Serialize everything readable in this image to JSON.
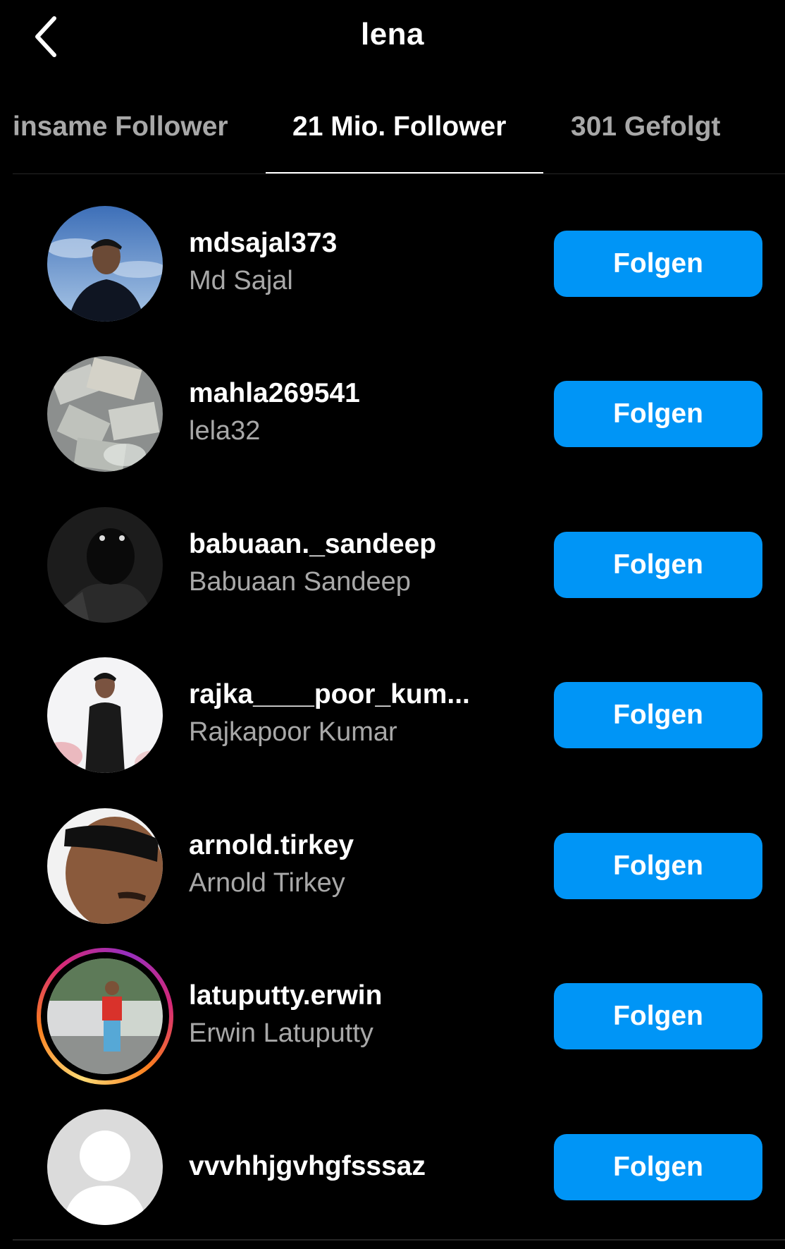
{
  "header": {
    "title": "lena",
    "back_icon": "chevron-left-icon"
  },
  "tabs": [
    {
      "label": "insame Follower",
      "active": false
    },
    {
      "label": "21 Mio. Follower",
      "active": true
    },
    {
      "label": "301 Gefolgt",
      "active": false
    }
  ],
  "colors": {
    "background": "#000000",
    "primary_text": "#ffffff",
    "secondary_text": "#a8a8a8",
    "follow_button": "#0095f6",
    "divider": "#262626"
  },
  "followers": [
    {
      "username": "mdsajal373",
      "full_name": "Md Sajal",
      "button": "Folgen",
      "has_story": false
    },
    {
      "username": "mahla269541",
      "full_name": "lela32",
      "button": "Folgen",
      "has_story": false
    },
    {
      "username": "babuaan._sandeep",
      "full_name": "Babuaan Sandeep",
      "button": "Folgen",
      "has_story": false
    },
    {
      "username": "rajka____poor_kum...",
      "full_name": "Rajkapoor Kumar",
      "button": "Folgen",
      "has_story": false
    },
    {
      "username": "arnold.tirkey",
      "full_name": "Arnold Tirkey",
      "button": "Folgen",
      "has_story": false
    },
    {
      "username": "latuputty.erwin",
      "full_name": "Erwin Latuputty",
      "button": "Folgen",
      "has_story": true
    },
    {
      "username": "vvvhhjgvhgfsssaz",
      "full_name": "",
      "button": "Folgen",
      "has_story": false
    }
  ]
}
